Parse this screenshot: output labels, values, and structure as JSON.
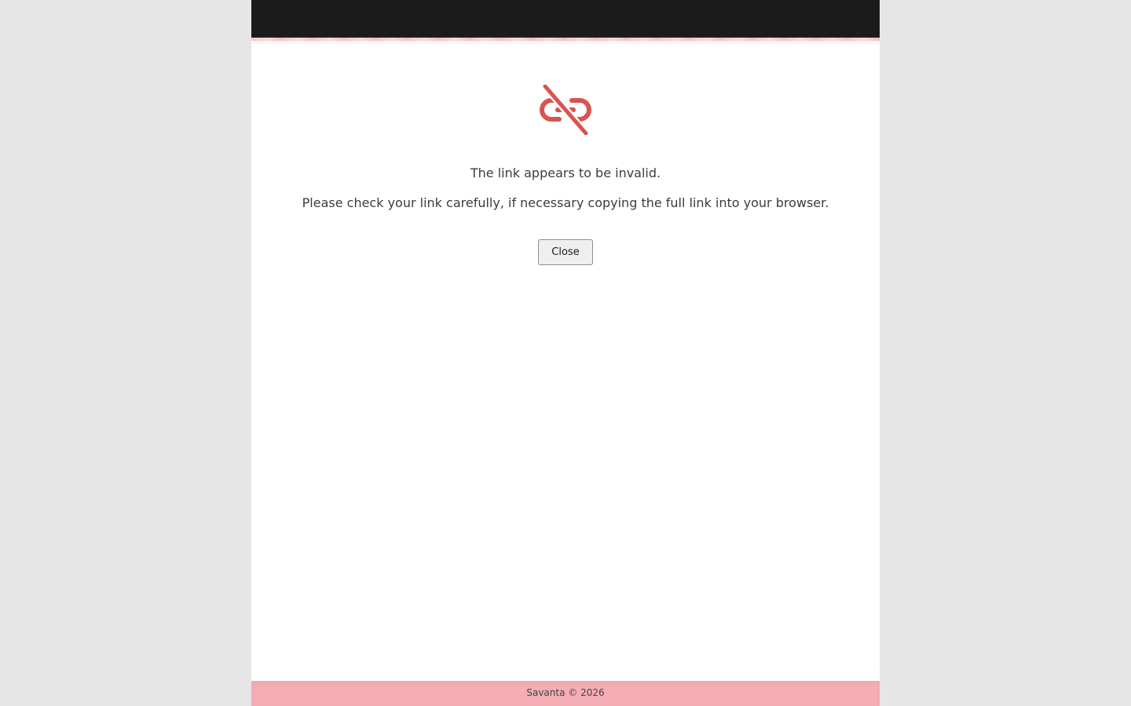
{
  "header": {
    "background_color": "#1c1b1c"
  },
  "main": {
    "icon": "broken-link-icon",
    "icon_color": "#d9534f",
    "message_primary": "The link appears to be invalid.",
    "message_secondary": "Please check your link carefully, if necessary copying the full link into your browser.",
    "close_label": "Close"
  },
  "footer": {
    "text": "Savanta © 2026",
    "background_color": "#f4aeb4"
  }
}
